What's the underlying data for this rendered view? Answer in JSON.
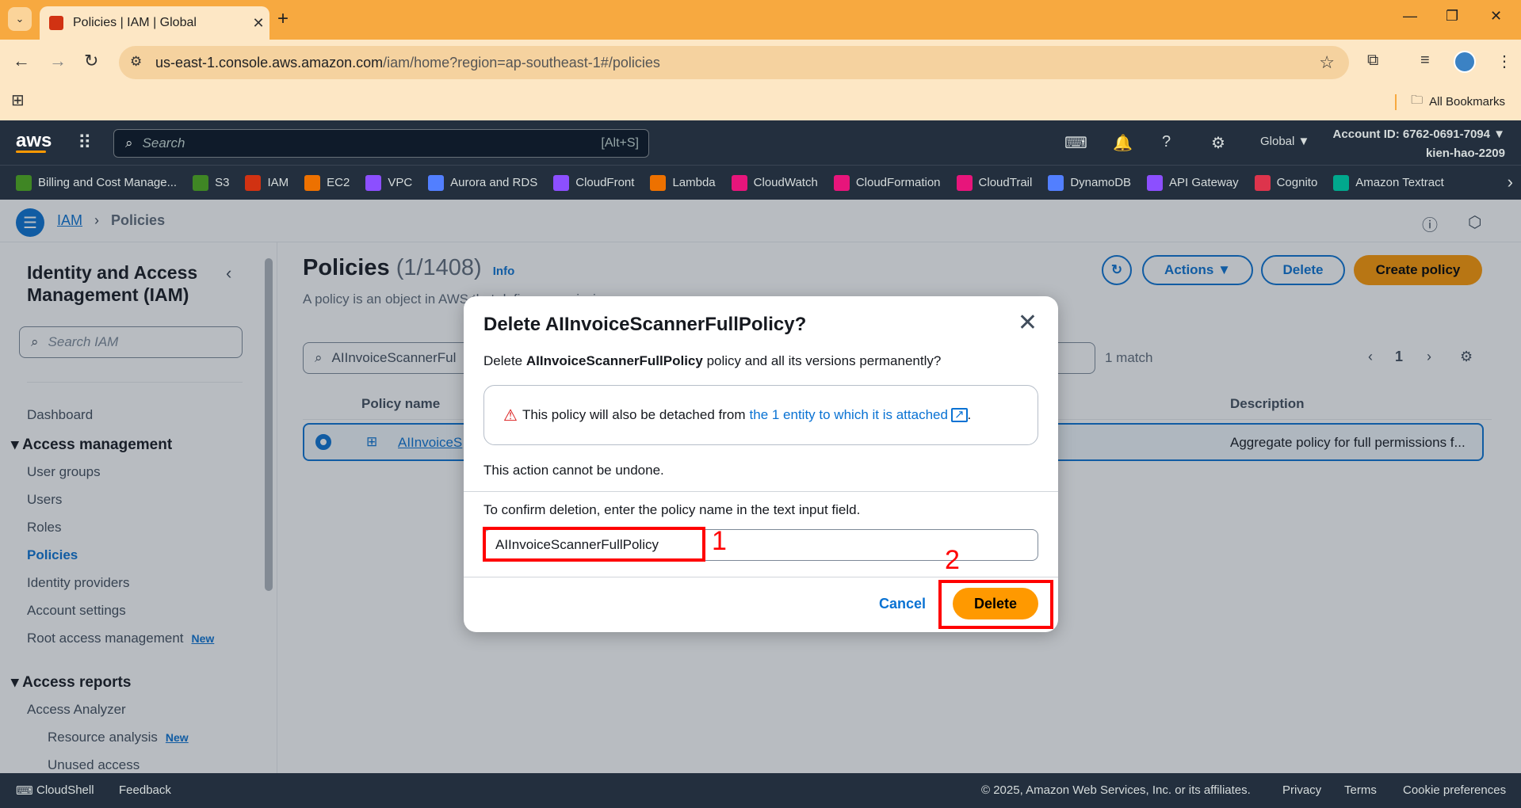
{
  "browser": {
    "tab_title": "Policies | IAM | Global",
    "url_host": "us-east-1.console.aws.amazon.com",
    "url_path": "/iam/home?region=ap-southeast-1#/policies",
    "bookmarks_label": "All Bookmarks"
  },
  "aws_header": {
    "logo": "aws",
    "search_placeholder": "Search",
    "search_shortcut": "[Alt+S]",
    "region": "Global ▼",
    "account_id": "Account ID: 6762-0691-7094 ▼",
    "username": "kien-hao-2209",
    "services": [
      {
        "label": "Billing and Cost Manage...",
        "color": "#3f8624"
      },
      {
        "label": "S3",
        "color": "#3f8624"
      },
      {
        "label": "IAM",
        "color": "#d13212"
      },
      {
        "label": "EC2",
        "color": "#ed7100"
      },
      {
        "label": "VPC",
        "color": "#8c4fff"
      },
      {
        "label": "Aurora and RDS",
        "color": "#527fff"
      },
      {
        "label": "CloudFront",
        "color": "#8c4fff"
      },
      {
        "label": "Lambda",
        "color": "#ed7100"
      },
      {
        "label": "CloudWatch",
        "color": "#e7157b"
      },
      {
        "label": "CloudFormation",
        "color": "#e7157b"
      },
      {
        "label": "CloudTrail",
        "color": "#e7157b"
      },
      {
        "label": "DynamoDB",
        "color": "#527fff"
      },
      {
        "label": "API Gateway",
        "color": "#8c4fff"
      },
      {
        "label": "Cognito",
        "color": "#dd344c"
      },
      {
        "label": "Amazon Textract",
        "color": "#01a88d"
      }
    ]
  },
  "breadcrumb": {
    "root": "IAM",
    "current": "Policies"
  },
  "sidebar": {
    "title": "Identity and Access Management (IAM)",
    "search_placeholder": "Search IAM",
    "dashboard": "Dashboard",
    "access_management": "Access management",
    "user_groups": "User groups",
    "users": "Users",
    "roles": "Roles",
    "policies": "Policies",
    "identity_providers": "Identity providers",
    "account_settings": "Account settings",
    "root_access": "Root access management",
    "new_badge": "New",
    "access_reports": "Access reports",
    "access_analyzer": "Access Analyzer",
    "resource_analysis": "Resource analysis",
    "unused_access": "Unused access"
  },
  "main": {
    "title": "Policies",
    "count": "(1/1408)",
    "info": "Info",
    "description": "A policy is an object in AWS that defines permissions.",
    "actions_label": "Actions ▼",
    "delete_label": "Delete",
    "create_label": "Create policy",
    "filter_value": "AIInvoiceScannerFul",
    "match_count": "1 match",
    "page_number": "1",
    "col_policy_name": "Policy name",
    "col_description": "Description",
    "row_name": "AIInvoiceS",
    "row_description": "Aggregate policy for full permissions f..."
  },
  "modal": {
    "title": "Delete AIInvoiceScannerFullPolicy?",
    "question_prefix": "Delete ",
    "question_name": "AIInvoiceScannerFullPolicy",
    "question_suffix": " policy and all its versions permanently?",
    "alert_text": "This policy will also be detached from",
    "alert_link": "the 1 entity to which it is attached",
    "alert_period": ".",
    "undone_text": "This action cannot be undone.",
    "confirm_text": "To confirm deletion, enter the policy name in the text input field.",
    "input_value": "AIInvoiceScannerFullPolicy",
    "cancel_label": "Cancel",
    "delete_label": "Delete"
  },
  "annotations": {
    "label_1": "1",
    "label_2": "2"
  },
  "footer": {
    "cloudshell": "CloudShell",
    "feedback": "Feedback",
    "copyright": "© 2025, Amazon Web Services, Inc. or its affiliates.",
    "privacy": "Privacy",
    "terms": "Terms",
    "cookies": "Cookie preferences"
  }
}
